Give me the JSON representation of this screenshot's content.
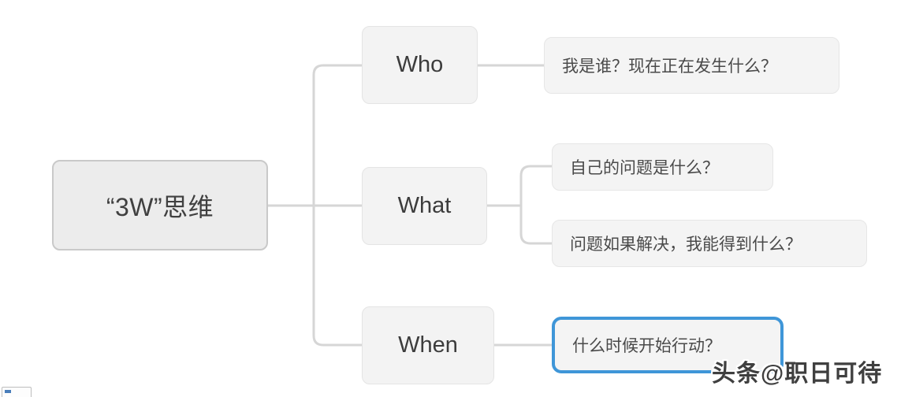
{
  "diagram": {
    "type": "mind-map",
    "title": "“3W”思维",
    "root": {
      "label": "“3W”思维"
    },
    "branches": [
      {
        "label": "Who",
        "leaves": [
          {
            "text": "我是谁？现在正在发生什么？",
            "selected": false
          }
        ]
      },
      {
        "label": "What",
        "leaves": [
          {
            "text": "自己的问题是什么？",
            "selected": false
          },
          {
            "text": "问题如果解决，我能得到什么？",
            "selected": false
          }
        ]
      },
      {
        "label": "When",
        "leaves": [
          {
            "text": "什么时候开始行动？",
            "selected": true
          }
        ]
      }
    ]
  },
  "watermark": {
    "text": "头条@职日可待"
  },
  "colors": {
    "node_fill": "#f2f2f2",
    "node_border": "#e3e3e3",
    "root_border": "#c9c9c9",
    "connector": "#d6d6d6",
    "selection_blue": "#3f96d8",
    "text": "#3f3f3f",
    "background": "#ffffff"
  }
}
